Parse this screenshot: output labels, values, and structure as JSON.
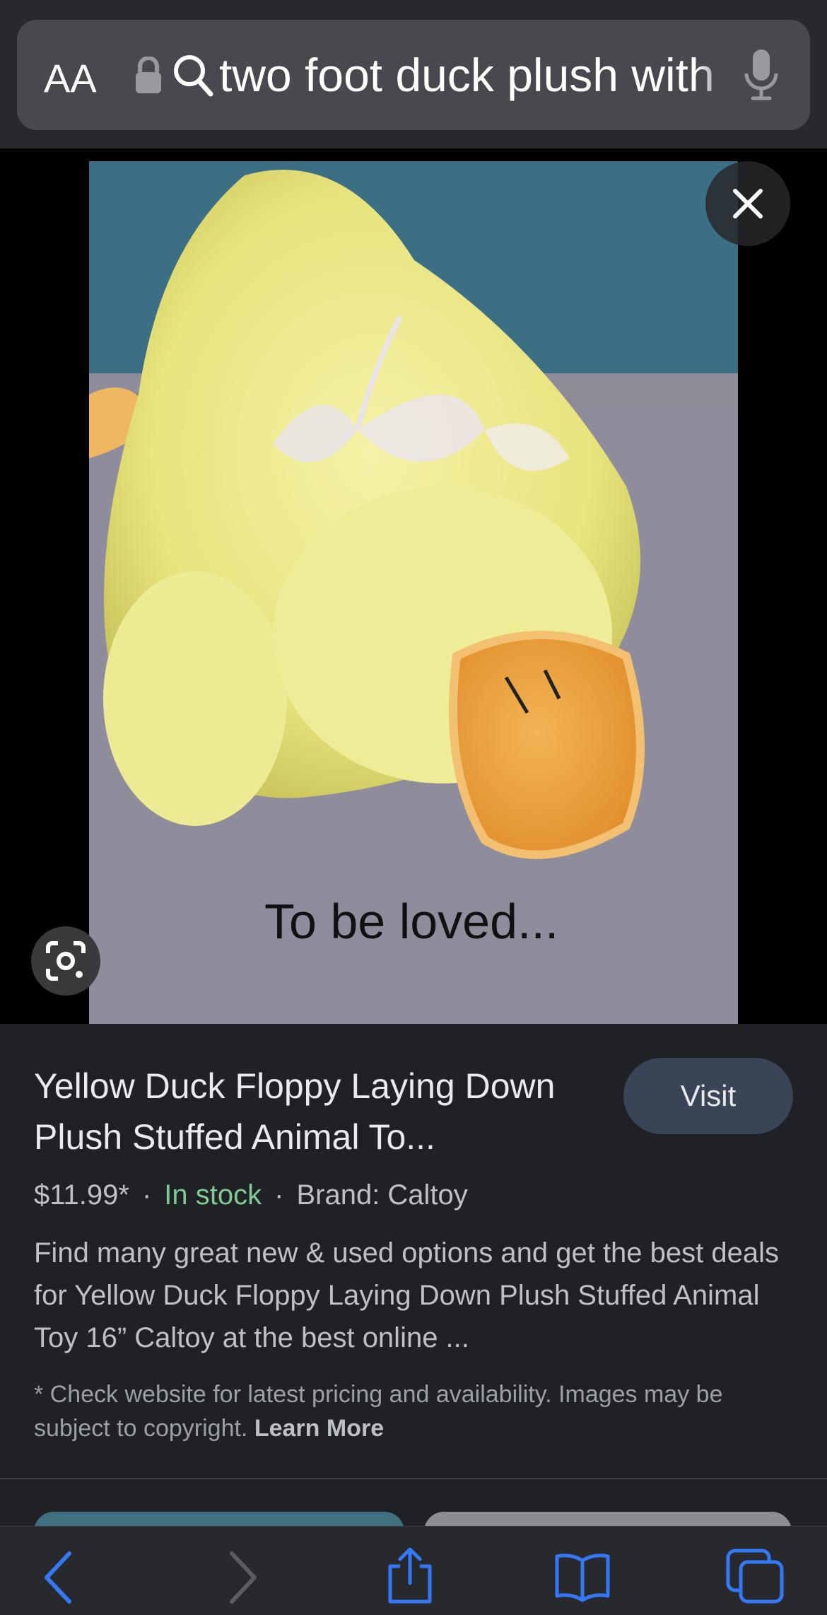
{
  "address_bar": {
    "text_size_button": "AA",
    "query": "two foot duck plush with bow"
  },
  "image": {
    "caption": "To be loved..."
  },
  "result": {
    "title": "Yellow Duck Floppy Laying Down Plush Stuffed Animal To...",
    "visit_label": "Visit",
    "price": "$11.99*",
    "stock": "In stock",
    "brand": "Brand: Caltoy",
    "description": "Find many great new & used options and get the best deals for Yellow Duck Floppy Laying Down Plush Stuffed Animal Toy 16” Caltoy at the best online ...",
    "disclaimer": "* Check website for latest pricing and availability. Images may be subject to copyright.",
    "learn_more": "Learn More"
  },
  "toolbar": {
    "icons": [
      "back-icon",
      "forward-icon",
      "share-icon",
      "bookmarks-icon",
      "tabs-icon"
    ]
  },
  "colors": {
    "accent_blue": "#3478f6",
    "in_stock_green": "#81c995",
    "panel_bg": "#202124"
  }
}
